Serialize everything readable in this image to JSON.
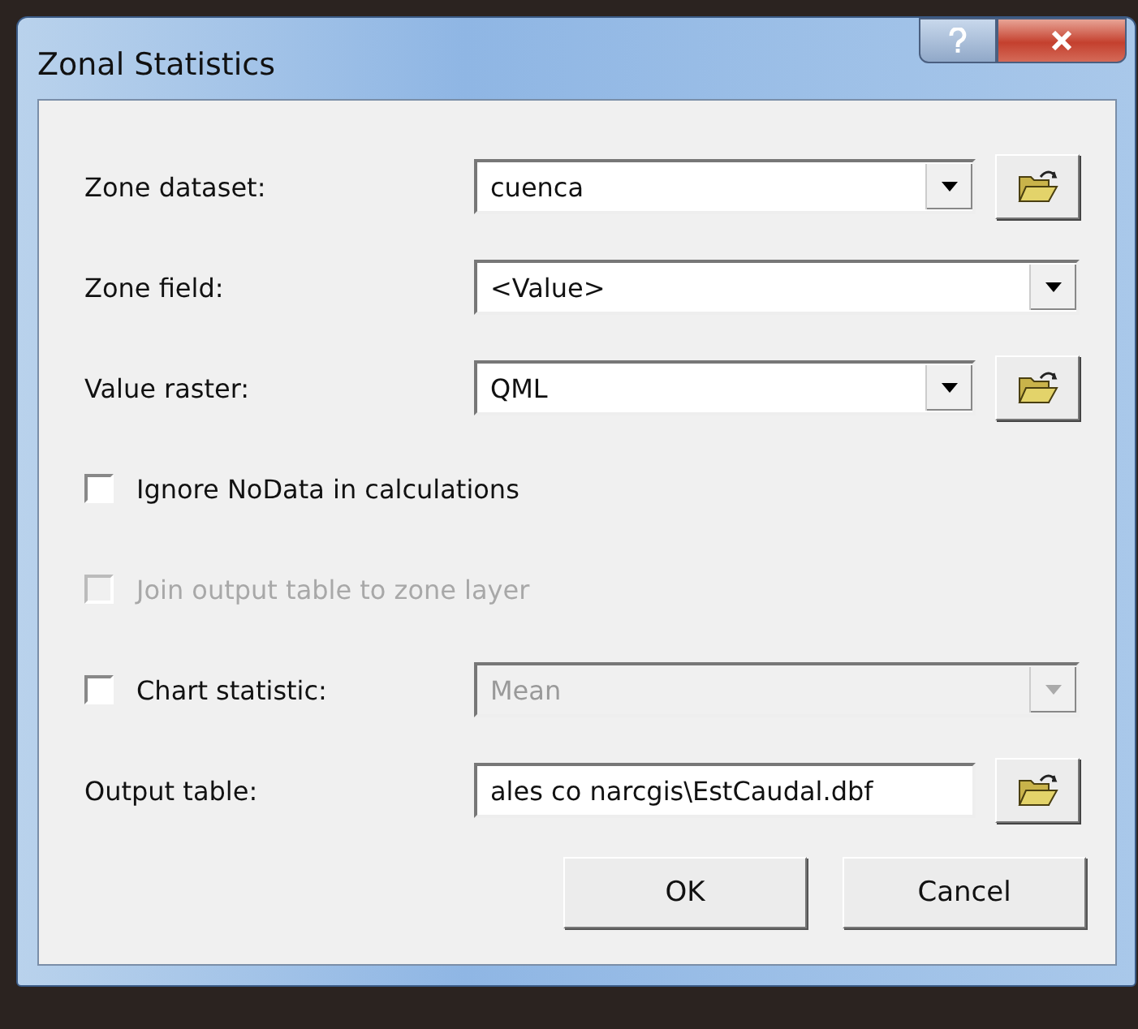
{
  "window": {
    "title": "Zonal Statistics"
  },
  "rows": [
    {
      "kind": "combo",
      "label": "Zone dataset:",
      "value": "cuenca",
      "browse": true
    },
    {
      "kind": "combo",
      "label": "Zone field:",
      "value": "<Value>",
      "browse": false
    },
    {
      "kind": "combo",
      "label": "Value raster:",
      "value": "QML",
      "browse": true
    },
    {
      "kind": "check",
      "label": "Ignore NoData in calculations",
      "checked": false,
      "disabled": false
    },
    {
      "kind": "check",
      "label": "Join output table to zone layer",
      "checked": false,
      "disabled": true
    },
    {
      "kind": "check_combo",
      "label": "Chart statistic:",
      "checked": false,
      "value": "Mean",
      "disabled": true
    },
    {
      "kind": "text",
      "label": "Output table:",
      "value": "ales co narcgis\\EstCaudal.dbf",
      "browse": true
    }
  ],
  "buttons": [
    "OK",
    "Cancel"
  ]
}
